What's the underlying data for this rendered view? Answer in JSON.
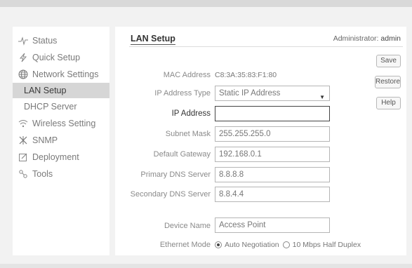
{
  "sidebar": {
    "items": [
      {
        "label": "Status",
        "icon": "pulse-icon"
      },
      {
        "label": "Quick Setup",
        "icon": "lightning-icon"
      },
      {
        "label": "Network Settings",
        "icon": "globe-icon"
      },
      {
        "label": "LAN Setup",
        "sub": true,
        "active": true
      },
      {
        "label": "DHCP Server",
        "sub": true
      },
      {
        "label": "Wireless Setting",
        "icon": "wifi-icon"
      },
      {
        "label": "SNMP",
        "icon": "snmp-icon"
      },
      {
        "label": "Deployment",
        "icon": "edit-icon"
      },
      {
        "label": "Tools",
        "icon": "tools-icon"
      }
    ]
  },
  "header": {
    "title": "LAN Setup",
    "admin_label": "Administrator:",
    "admin_user": "admin"
  },
  "actions": {
    "save": "Save",
    "restore": "Restore",
    "help": "Help"
  },
  "form": {
    "mac": {
      "label": "MAC Address",
      "value": "C8:3A:35:83:F1:80"
    },
    "ip_type": {
      "label": "IP Address Type",
      "value": "Static IP Address"
    },
    "ip_address": {
      "label": "IP Address",
      "value": ""
    },
    "subnet": {
      "label": "Subnet Mask",
      "value": "255.255.255.0"
    },
    "gateway": {
      "label": "Default Gateway",
      "value": "192.168.0.1"
    },
    "dns1": {
      "label": "Primary DNS Server",
      "value": "8.8.8.8"
    },
    "dns2": {
      "label": "Secondary DNS Server",
      "value": "8.8.4.4"
    },
    "device": {
      "label": "Device Name",
      "value": "Access Point"
    },
    "ethernet": {
      "label": "Ethernet Mode",
      "options": [
        "Auto Negotiation",
        "10 Mbps Half Duplex"
      ],
      "selected": "Auto Negotiation"
    }
  }
}
